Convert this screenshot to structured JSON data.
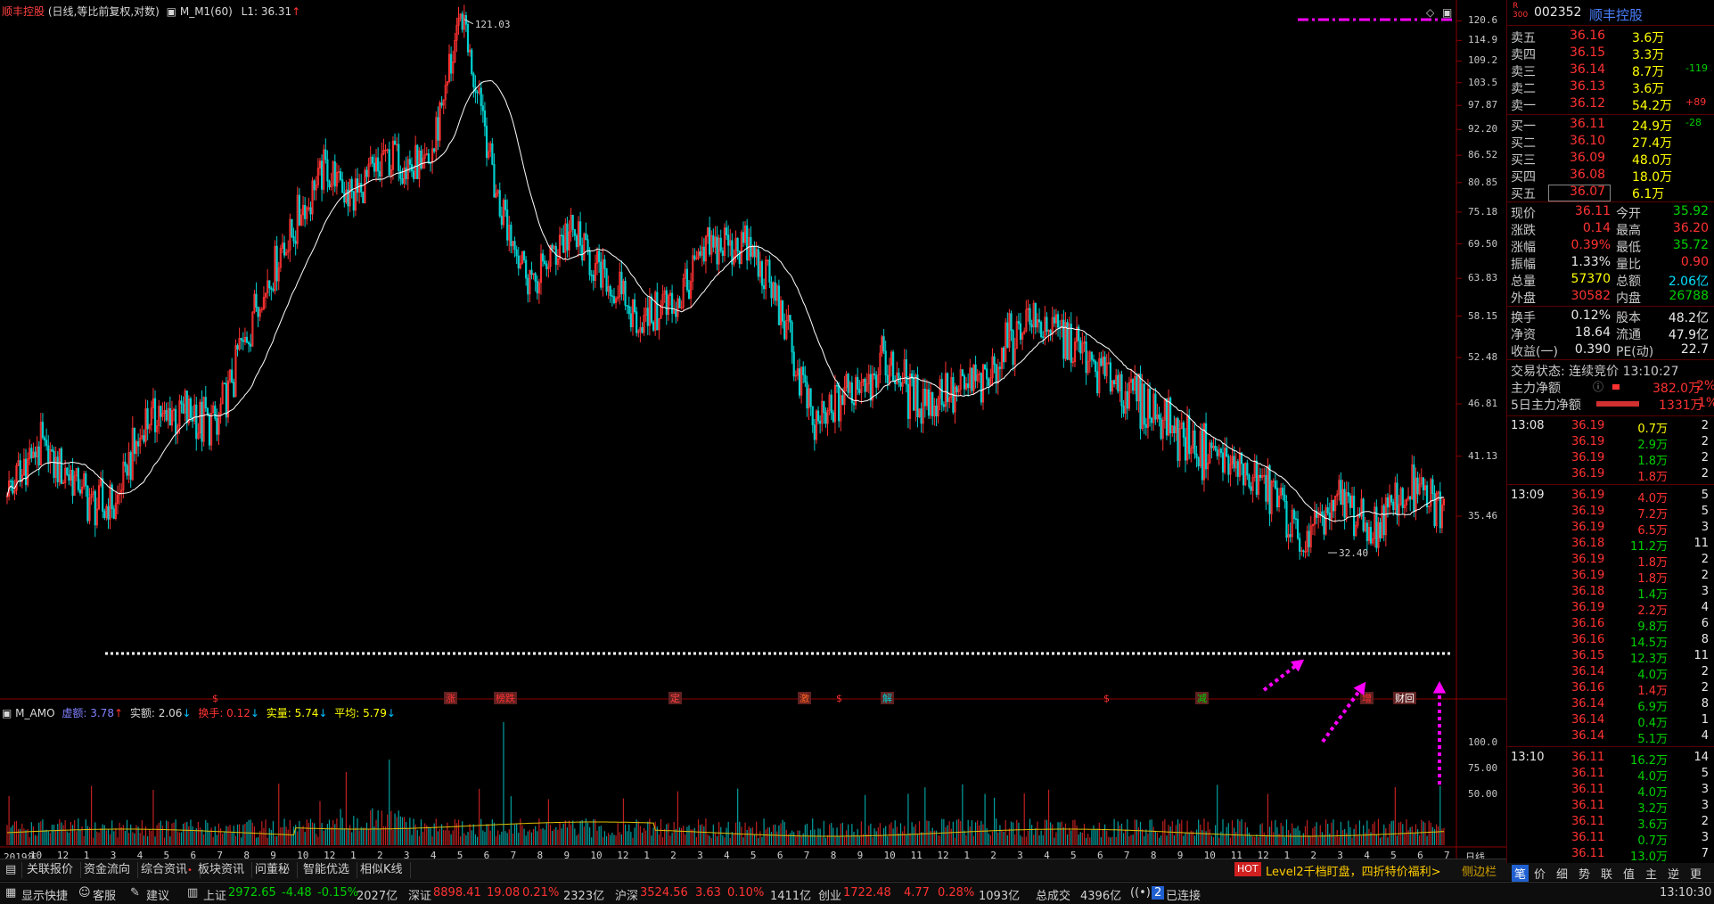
{
  "header": {
    "stock_name": "顺丰控股",
    "chart_mode": "(日线,等比前复权,对数)",
    "indicator": "M_M1(60)",
    "l1_label": "L1: 36.31",
    "l1_arrow": "↑"
  },
  "price_axis": {
    "labels": [
      "120.6",
      "114.9",
      "109.2",
      "103.5",
      "97.87",
      "92.20",
      "86.52",
      "80.85",
      "75.18",
      "69.50",
      "63.83",
      "58.15",
      "52.48",
      "46.81",
      "41.13",
      "35.46"
    ]
  },
  "annotations": {
    "high": "121.03",
    "low": "32.40",
    "event_marks": [
      "$",
      "涨",
      "榜跌",
      "定",
      "激",
      "$",
      "解",
      "$",
      "减",
      "增",
      "财回"
    ]
  },
  "volume_indicator": {
    "name": "M_AMO",
    "xu_e": "虚额: 3.78",
    "shi_e": "实额: 2.06",
    "huan_shou": "换手: 0.12",
    "shi_liang": "实量: 5.74",
    "ping_jun": "平均: 5.79",
    "axis_labels": [
      "100.0",
      "75.00",
      "50.00"
    ]
  },
  "x_axis": {
    "labels": [
      "2019年",
      "10",
      "12",
      "1",
      "3",
      "4",
      "5",
      "6",
      "7",
      "8",
      "9",
      "10",
      "12",
      "1",
      "2",
      "3",
      "4",
      "5",
      "6",
      "7",
      "8",
      "9",
      "10",
      "12",
      "1",
      "2",
      "3",
      "4",
      "5",
      "6",
      "7",
      "8",
      "9",
      "10",
      "11",
      "12",
      "1",
      "2",
      "3",
      "4",
      "5",
      "6",
      "7",
      "8",
      "9",
      "10",
      "11",
      "12",
      "1",
      "2",
      "3",
      "4",
      "5",
      "6",
      "7"
    ],
    "period": "日线"
  },
  "chart_data": {
    "type": "candlestick",
    "title": "顺丰控股",
    "period": "日线",
    "ylim": [
      32.4,
      121.03
    ],
    "scale": "log",
    "close_path": [
      {
        "t": "2019-09",
        "v": 38
      },
      {
        "t": "2019-10",
        "v": 42
      },
      {
        "t": "2019-12",
        "v": 38
      },
      {
        "t": "2020-01",
        "v": 36
      },
      {
        "t": "2020-03",
        "v": 45
      },
      {
        "t": "2020-04",
        "v": 46
      },
      {
        "t": "2020-05",
        "v": 44
      },
      {
        "t": "2020-06",
        "v": 58
      },
      {
        "t": "2020-07",
        "v": 70
      },
      {
        "t": "2020-08",
        "v": 84
      },
      {
        "t": "2020-09",
        "v": 78
      },
      {
        "t": "2020-10",
        "v": 88
      },
      {
        "t": "2020-12",
        "v": 82
      },
      {
        "t": "2021-02",
        "v": 121
      },
      {
        "t": "2021-03",
        "v": 78
      },
      {
        "t": "2021-04",
        "v": 62
      },
      {
        "t": "2021-05",
        "v": 72
      },
      {
        "t": "2021-06",
        "v": 64
      },
      {
        "t": "2021-07",
        "v": 58
      },
      {
        "t": "2021-08",
        "v": 60
      },
      {
        "t": "2021-09",
        "v": 68
      },
      {
        "t": "2021-10",
        "v": 70
      },
      {
        "t": "2021-12",
        "v": 60
      },
      {
        "t": "2022-01",
        "v": 44
      },
      {
        "t": "2022-02",
        "v": 48
      },
      {
        "t": "2022-03",
        "v": 52
      },
      {
        "t": "2022-04",
        "v": 47
      },
      {
        "t": "2022-05",
        "v": 48
      },
      {
        "t": "2022-06",
        "v": 50
      },
      {
        "t": "2022-07",
        "v": 58
      },
      {
        "t": "2022-08",
        "v": 56
      },
      {
        "t": "2022-09",
        "v": 52
      },
      {
        "t": "2022-10",
        "v": 48
      },
      {
        "t": "2022-11",
        "v": 45
      },
      {
        "t": "2022-12",
        "v": 42
      },
      {
        "t": "2023-01",
        "v": 40
      },
      {
        "t": "2023-02",
        "v": 38
      },
      {
        "t": "2023-03",
        "v": 32.4
      },
      {
        "t": "2023-04",
        "v": 37
      },
      {
        "t": "2023-05",
        "v": 34
      },
      {
        "t": "2023-06",
        "v": 38
      },
      {
        "t": "2023-07",
        "v": 36
      }
    ]
  },
  "quote": {
    "code": "002352",
    "name": "顺丰控股",
    "badge_top": "R",
    "badge_bottom": "300",
    "asks": [
      {
        "label": "卖五",
        "price": "36.16",
        "vol": "3.6万",
        "chg": ""
      },
      {
        "label": "卖四",
        "price": "36.15",
        "vol": "3.3万",
        "chg": ""
      },
      {
        "label": "卖三",
        "price": "36.14",
        "vol": "8.7万",
        "chg": "-119"
      },
      {
        "label": "卖二",
        "price": "36.13",
        "vol": "3.6万",
        "chg": ""
      },
      {
        "label": "卖一",
        "price": "36.12",
        "vol": "54.2万",
        "chg": "+89"
      }
    ],
    "bids": [
      {
        "label": "买一",
        "price": "36.11",
        "vol": "24.9万",
        "chg": "-28"
      },
      {
        "label": "买二",
        "price": "36.10",
        "vol": "27.4万",
        "chg": ""
      },
      {
        "label": "买三",
        "price": "36.09",
        "vol": "48.0万",
        "chg": ""
      },
      {
        "label": "买四",
        "price": "36.08",
        "vol": "18.0万",
        "chg": ""
      },
      {
        "label": "买五",
        "price": "36.07",
        "vol": "6.1万",
        "chg": ""
      }
    ],
    "stats": [
      {
        "l1": "现价",
        "v1": "36.11",
        "l2": "今开",
        "v2": "35.92"
      },
      {
        "l1": "涨跌",
        "v1": "0.14",
        "l2": "最高",
        "v2": "36.20"
      },
      {
        "l1": "涨幅",
        "v1": "0.39%",
        "l2": "最低",
        "v2": "35.72"
      },
      {
        "l1": "振幅",
        "v1": "1.33%",
        "l2": "量比",
        "v2": "0.90"
      },
      {
        "l1": "总量",
        "v1": "57370",
        "l2": "总额",
        "v2": "2.06亿"
      },
      {
        "l1": "外盘",
        "v1": "30582",
        "l2": "内盘",
        "v2": "26788"
      }
    ],
    "stats2": [
      {
        "l1": "换手",
        "v1": "0.12%",
        "l2": "股本",
        "v2": "48.2亿"
      },
      {
        "l1": "净资",
        "v1": "18.64",
        "l2": "流通",
        "v2": "47.9亿"
      },
      {
        "l1": "收益(一)",
        "v1": "0.390",
        "l2": "PE(动)",
        "v2": "22.7"
      }
    ],
    "trade_status": "交易状态: 连续竞价 13:10:27",
    "main_flow": {
      "label": "主力净额",
      "value": "382.0万",
      "pct": "2%"
    },
    "main_flow5": {
      "label": "5日主力净额",
      "value": "1331万",
      "pct": "1%"
    }
  },
  "ticks": [
    {
      "time": "13:08",
      "price": "36.19",
      "vol": "0.7万",
      "n": "2",
      "pc": "r",
      "vc": "y"
    },
    {
      "time": "",
      "price": "36.19",
      "vol": "2.9万",
      "n": "2",
      "pc": "r",
      "vc": "g"
    },
    {
      "time": "",
      "price": "36.19",
      "vol": "1.8万",
      "n": "2",
      "pc": "r",
      "vc": "g"
    },
    {
      "time": "",
      "price": "36.19",
      "vol": "1.8万",
      "n": "2",
      "pc": "r",
      "vc": "r"
    },
    {
      "time": "13:09",
      "price": "36.19",
      "vol": "4.0万",
      "n": "5",
      "pc": "r",
      "vc": "r"
    },
    {
      "time": "",
      "price": "36.19",
      "vol": "7.2万",
      "n": "5",
      "pc": "r",
      "vc": "r"
    },
    {
      "time": "",
      "price": "36.19",
      "vol": "6.5万",
      "n": "3",
      "pc": "r",
      "vc": "r"
    },
    {
      "time": "",
      "price": "36.18",
      "vol": "11.2万",
      "n": "11",
      "pc": "r",
      "vc": "g"
    },
    {
      "time": "",
      "price": "36.19",
      "vol": "1.8万",
      "n": "2",
      "pc": "r",
      "vc": "r"
    },
    {
      "time": "",
      "price": "36.19",
      "vol": "1.8万",
      "n": "2",
      "pc": "r",
      "vc": "r"
    },
    {
      "time": "",
      "price": "36.18",
      "vol": "1.4万",
      "n": "3",
      "pc": "r",
      "vc": "g"
    },
    {
      "time": "",
      "price": "36.19",
      "vol": "2.2万",
      "n": "4",
      "pc": "r",
      "vc": "r"
    },
    {
      "time": "",
      "price": "36.16",
      "vol": "9.8万",
      "n": "6",
      "pc": "r",
      "vc": "g"
    },
    {
      "time": "",
      "price": "36.16",
      "vol": "14.5万",
      "n": "8",
      "pc": "r",
      "vc": "g"
    },
    {
      "time": "",
      "price": "36.15",
      "vol": "12.3万",
      "n": "11",
      "pc": "r",
      "vc": "g"
    },
    {
      "time": "",
      "price": "36.14",
      "vol": "4.0万",
      "n": "2",
      "pc": "r",
      "vc": "g"
    },
    {
      "time": "",
      "price": "36.16",
      "vol": "1.4万",
      "n": "2",
      "pc": "r",
      "vc": "r"
    },
    {
      "time": "",
      "price": "36.14",
      "vol": "6.9万",
      "n": "8",
      "pc": "r",
      "vc": "g"
    },
    {
      "time": "",
      "price": "36.14",
      "vol": "0.4万",
      "n": "1",
      "pc": "r",
      "vc": "g"
    },
    {
      "time": "",
      "price": "36.14",
      "vol": "5.1万",
      "n": "4",
      "pc": "r",
      "vc": "g"
    },
    {
      "time": "13:10",
      "price": "36.11",
      "vol": "16.2万",
      "n": "14",
      "pc": "r",
      "vc": "g"
    },
    {
      "time": "",
      "price": "36.11",
      "vol": "4.0万",
      "n": "5",
      "pc": "r",
      "vc": "g"
    },
    {
      "time": "",
      "price": "36.11",
      "vol": "4.0万",
      "n": "3",
      "pc": "r",
      "vc": "g"
    },
    {
      "time": "",
      "price": "36.11",
      "vol": "3.2万",
      "n": "3",
      "pc": "r",
      "vc": "g"
    },
    {
      "time": "",
      "price": "36.11",
      "vol": "3.6万",
      "n": "2",
      "pc": "r",
      "vc": "g"
    },
    {
      "time": "",
      "price": "36.11",
      "vol": "0.7万",
      "n": "3",
      "pc": "r",
      "vc": "g"
    },
    {
      "time": "",
      "price": "36.11",
      "vol": "13.0万",
      "n": "7",
      "pc": "r",
      "vc": "g"
    }
  ],
  "bottom_tabs": [
    "关联报价",
    "资金流向",
    "综合资讯",
    "板块资讯",
    "问董秘",
    "智能优选",
    "相似K线"
  ],
  "hot": {
    "badge": "HOT",
    "text": "Level2千档盯盘，四折特价福利>",
    "side": "侧边栏"
  },
  "right_tabs": [
    "笔",
    "价",
    "细",
    "势",
    "联",
    "值",
    "主",
    "逆",
    "更"
  ],
  "status": {
    "show_quick": "显示快捷",
    "service": "客服",
    "suggest": "建议",
    "sh_label": "上证",
    "sh_val": "2972.65",
    "sh_chg": "-4.48",
    "sh_pct": "-0.15%",
    "sh_amt": "2027亿",
    "sz_label": "深证",
    "sz_val": "8898.41",
    "sz_chg": "19.08",
    "sz_pct": "0.21%",
    "sz_amt": "2323亿",
    "hs_label": "沪深",
    "hs_val": "3524.56",
    "hs_chg": "3.63",
    "hs_pct": "0.10%",
    "hs_amt": "1411亿",
    "cy_label": "创业",
    "cy_val": "1722.48",
    "cy_chg": "4.77",
    "cy_pct": "0.28%",
    "cy_amt": "1093亿",
    "total_label": "总成交",
    "total_val": "4396亿",
    "conn": "已连接",
    "conn_num": "2",
    "clock": "13:10:30"
  },
  "colors": {
    "up": "#ff3232",
    "down": "#00d0d0",
    "ma": "#ffffff",
    "dashed": "#ffffff",
    "arrow": "#ff00ff"
  }
}
